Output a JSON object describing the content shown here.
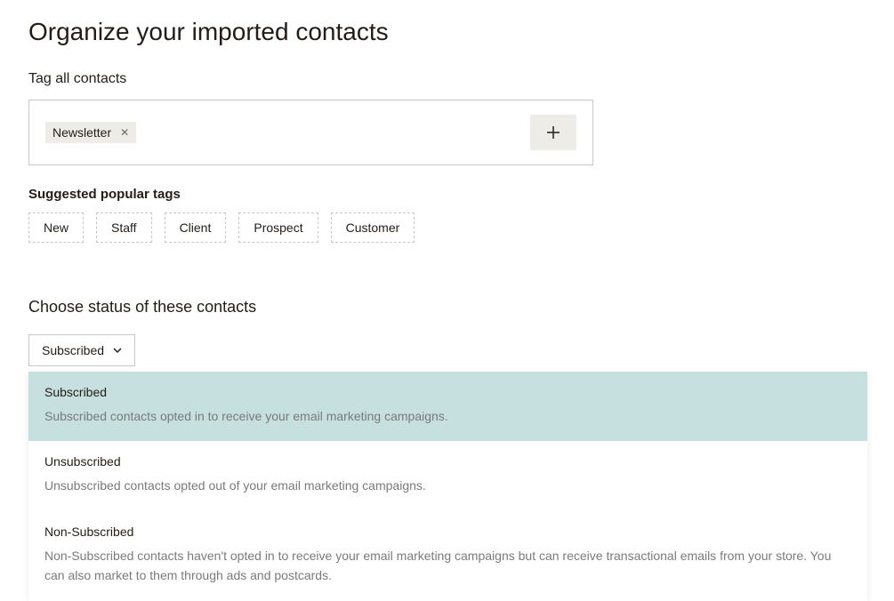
{
  "page_title": "Organize your imported contacts",
  "tag_section": {
    "label": "Tag all contacts",
    "tags": [
      {
        "label": "Newsletter"
      }
    ]
  },
  "suggested": {
    "label": "Suggested popular tags",
    "items": [
      "New",
      "Staff",
      "Client",
      "Prospect",
      "Customer"
    ]
  },
  "status": {
    "label": "Choose status of these contacts",
    "selected": "Subscribed",
    "options": [
      {
        "title": "Subscribed",
        "desc": "Subscribed contacts opted in to receive your email marketing campaigns.",
        "selected": true
      },
      {
        "title": "Unsubscribed",
        "desc": "Unsubscribed contacts opted out of your email marketing campaigns.",
        "selected": false
      },
      {
        "title": "Non-Subscribed",
        "desc": "Non-Subscribed contacts haven't opted in to receive your email marketing campaigns but can receive transactional emails from your store. You can also market to them through ads and postcards.",
        "selected": false
      }
    ]
  }
}
